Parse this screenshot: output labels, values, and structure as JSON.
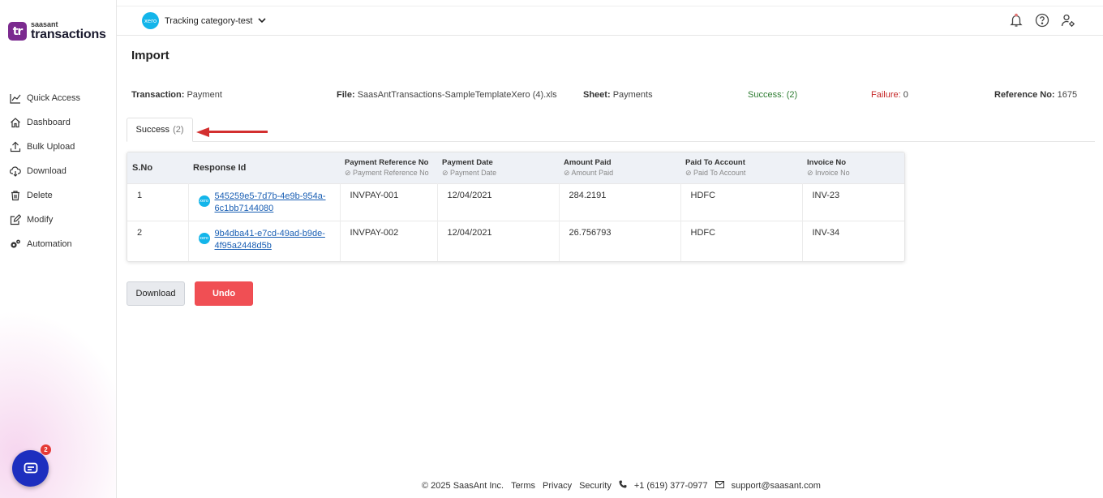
{
  "brand": {
    "mark": "tr",
    "small": "saasant",
    "big": "transactions"
  },
  "sidebar": {
    "items": [
      {
        "label": "Quick Access",
        "icon": "chart-line-icon"
      },
      {
        "label": "Dashboard",
        "icon": "home-icon"
      },
      {
        "label": "Bulk Upload",
        "icon": "upload-icon"
      },
      {
        "label": "Download",
        "icon": "cloud-download-icon"
      },
      {
        "label": "Delete",
        "icon": "trash-icon"
      },
      {
        "label": "Modify",
        "icon": "edit-icon"
      },
      {
        "label": "Automation",
        "icon": "gears-icon"
      }
    ],
    "chat_badge": "2"
  },
  "topbar": {
    "org_logo": "xero",
    "org_name": "Tracking category-test"
  },
  "page": {
    "title": "Import"
  },
  "summary": {
    "transaction_label": "Transaction:",
    "transaction_value": "Payment",
    "file_label": "File:",
    "file_value": "SaasAntTransactions-SampleTemplateXero (4).xls",
    "sheet_label": "Sheet:",
    "sheet_value": "Payments",
    "success_label": "Success:",
    "success_value": "(2)",
    "failure_label": "Failure:",
    "failure_value": "0",
    "reference_label": "Reference No:",
    "reference_value": "1675"
  },
  "tab": {
    "label": "Success",
    "count": "(2)"
  },
  "table": {
    "headers": {
      "sno": "S.No",
      "response": "Response Id",
      "payment_ref": "Payment Reference No",
      "payment_ref_sub": "Payment Reference No",
      "payment_date": "Payment Date",
      "payment_date_sub": "Payment Date",
      "amount": "Amount Paid",
      "amount_sub": "Amount Paid",
      "account": "Paid To Account",
      "account_sub": "Paid To Account",
      "invoice": "Invoice No",
      "invoice_sub": "Invoice No"
    },
    "rows": [
      {
        "sno": "1",
        "response_id": "545259e5-7d7b-4e9b-954a-6c1bb7144080",
        "payment_ref": "INVPAY-001",
        "payment_date": "12/04/2021",
        "amount": "284.2191",
        "account": "HDFC",
        "invoice": "INV-23"
      },
      {
        "sno": "2",
        "response_id": "9b4dba41-e7cd-49ad-b9de-4f95a2448d5b",
        "payment_ref": "INVPAY-002",
        "payment_date": "12/04/2021",
        "amount": "26.756793",
        "account": "HDFC",
        "invoice": "INV-34"
      }
    ]
  },
  "actions": {
    "download": "Download",
    "undo": "Undo"
  },
  "footer": {
    "copyright": "© 2025 SaasAnt Inc.",
    "terms": "Terms",
    "privacy": "Privacy",
    "security": "Security",
    "phone": "+1 (619) 377-0977",
    "email": "support@saasant.com"
  },
  "colors": {
    "brand": "#7b2a8f",
    "xero": "#13b5ea",
    "success": "#2e7d32",
    "failure": "#c62828",
    "undo": "#f04f54",
    "chat": "#1d2fbf"
  }
}
